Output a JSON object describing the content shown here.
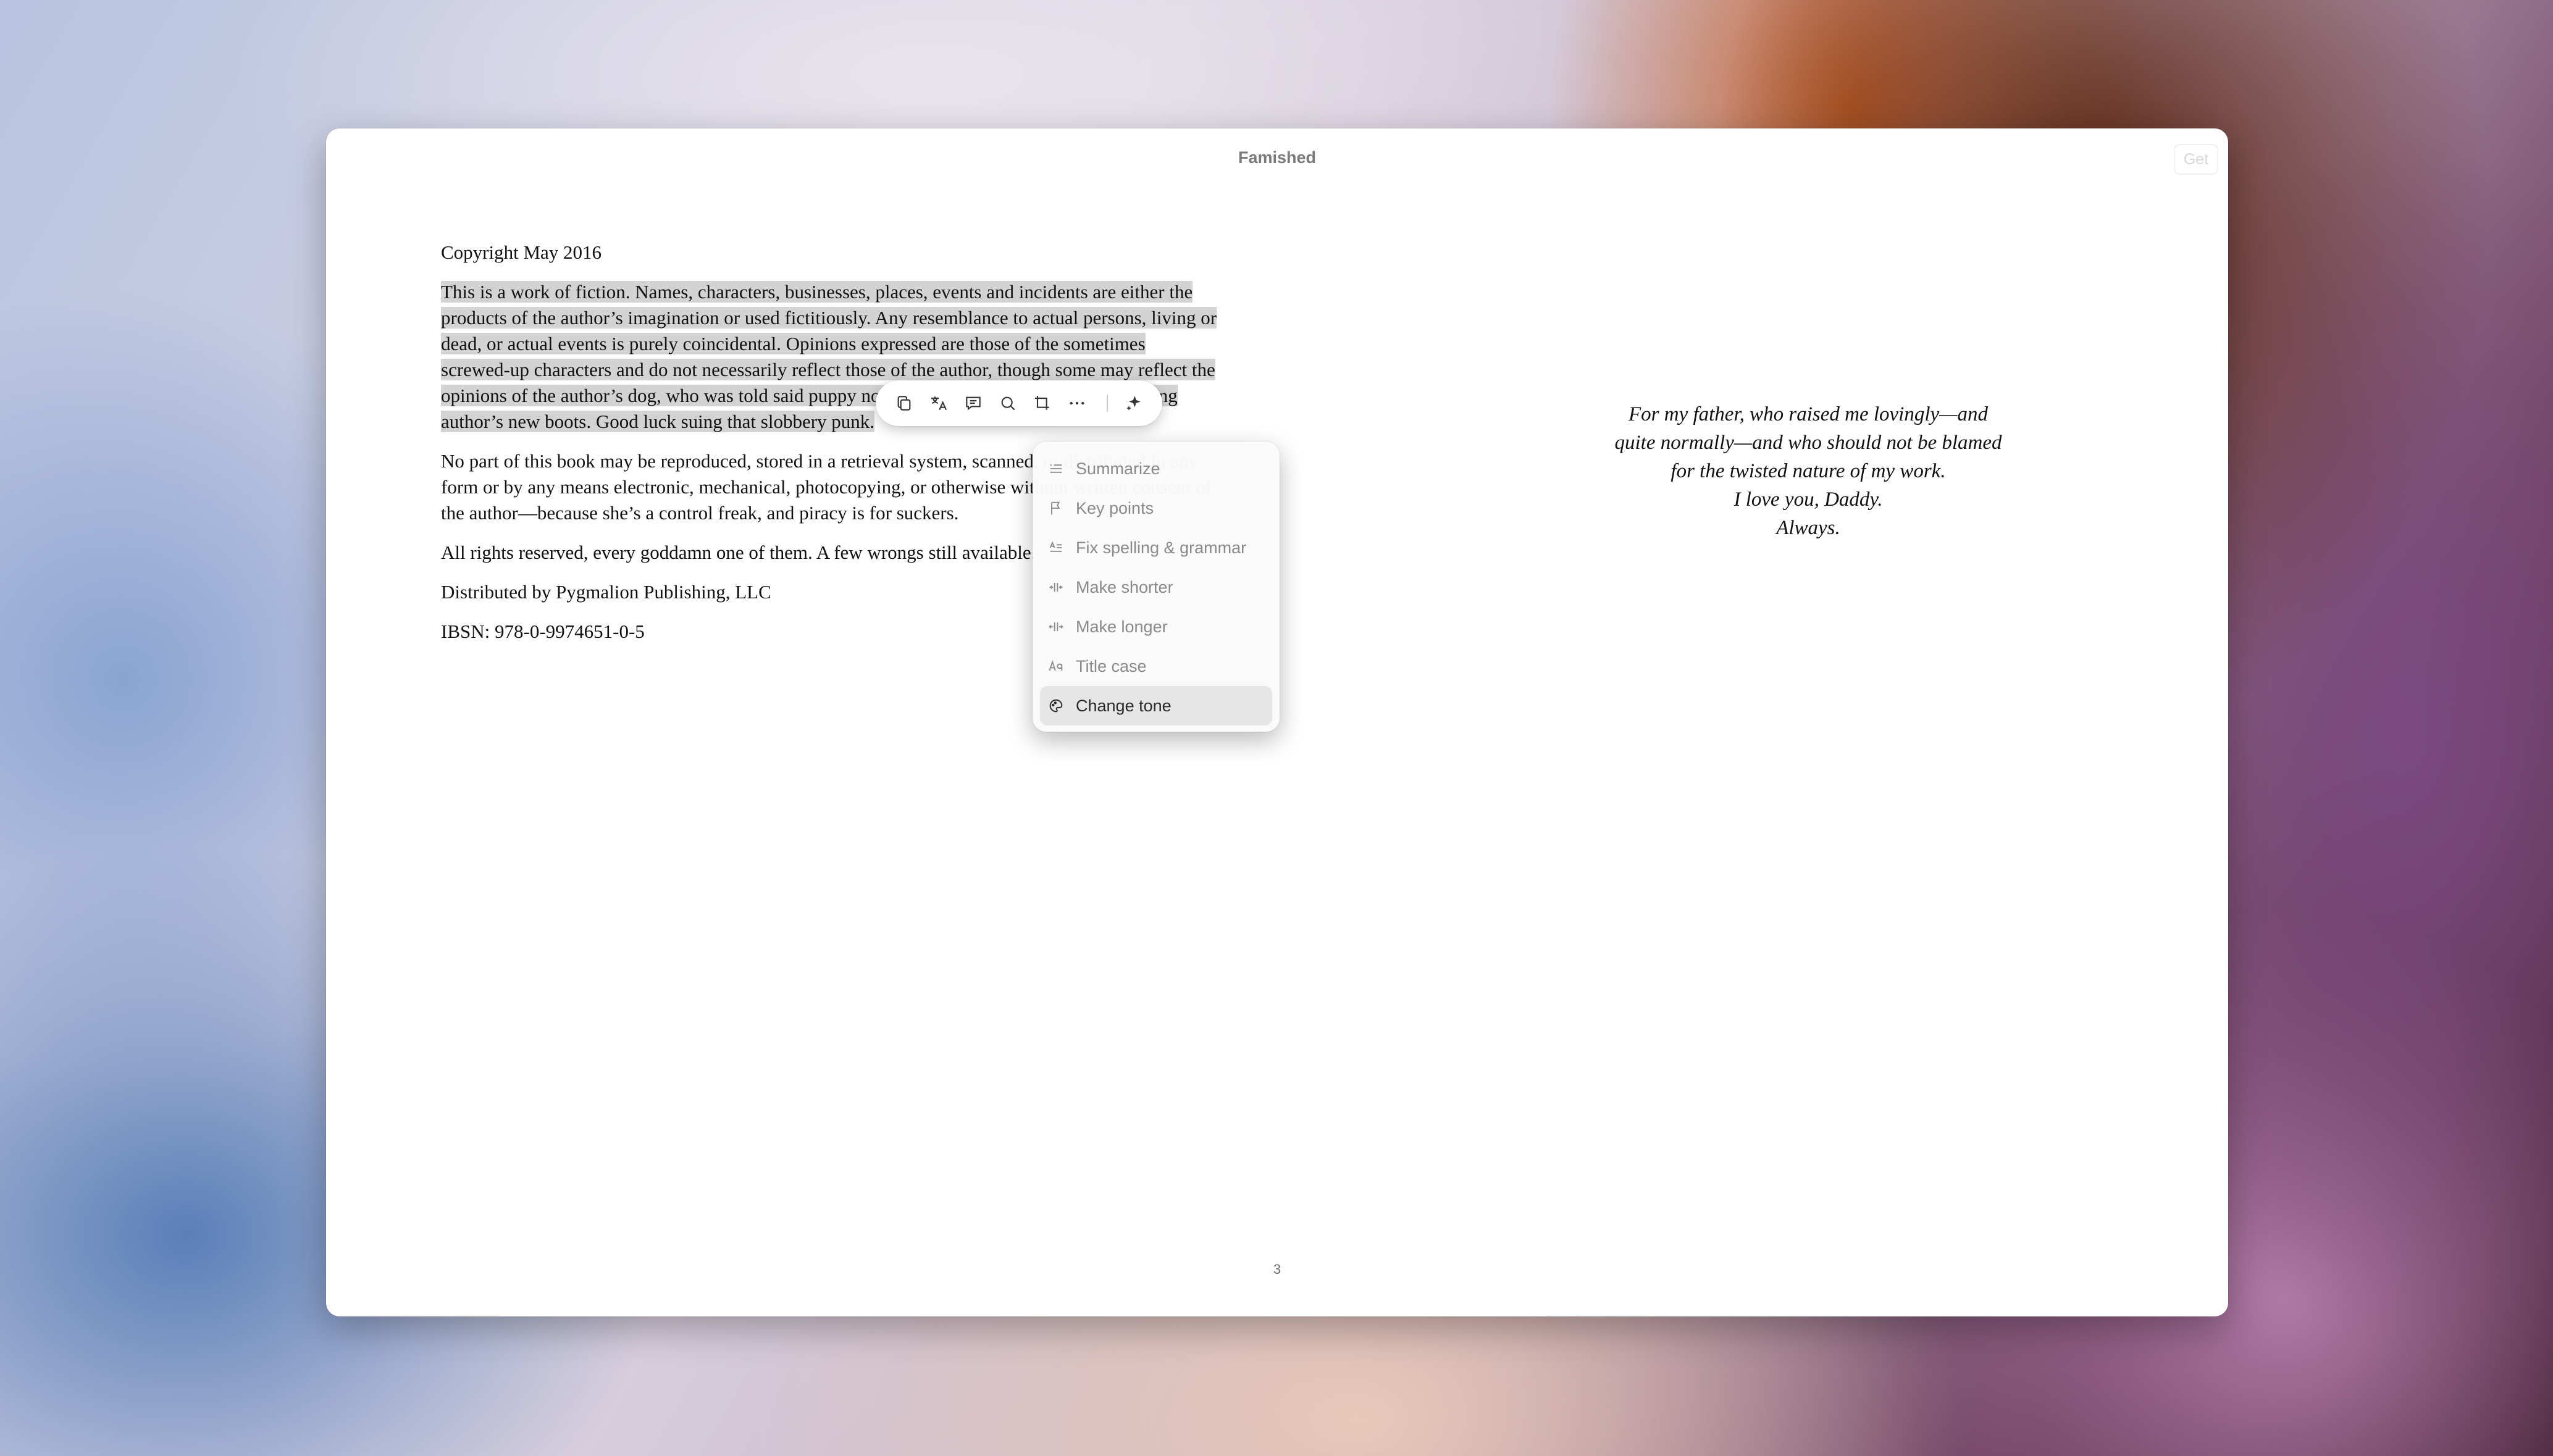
{
  "window": {
    "title": "Famished",
    "get_button_label": "Get"
  },
  "left_page": {
    "copyright_line": "Copyright May 2016",
    "selected_paragraph": "This is a work of fiction. Names, characters, businesses, places, events and incidents are either the products of the author’s imagination or used fictitiously. Any resemblance to actual persons, living or dead, or actual events is purely coincidental. Opinions expressed are those of the sometimes screwed-up characters and do not necessarily reflect those of the author, though some may reflect the opinions of the author’s dog, who was told said puppy not to be a jerk. Dog responded by eating author’s new boots. Good luck suing that slobbery punk.",
    "reproduction_paragraph": "No part of this book may be reproduced, stored in a retrieval system, scanned, or distributed in any form or by any means electronic, mechanical, photocopying, or otherwise without written consent of the author—because she’s a control freak, and piracy is for suckers.",
    "rights_line": "All rights reserved, every goddamn one of them. A few wrongs still available.",
    "distributor_line": "Distributed by Pygmalion Publishing, LLC",
    "ibsn_line": "IBSN: 978-0-9974651-0-5"
  },
  "right_page": {
    "dedication_lines": [
      "For my father, who raised me lovingly—and",
      "quite normally—and who should not be blamed",
      "for the twisted nature of my work.",
      "I love you, Daddy.",
      "Always."
    ]
  },
  "page_number": "3",
  "selection_toolbar": {
    "buttons": [
      {
        "name": "copy-icon"
      },
      {
        "name": "translate-icon"
      },
      {
        "name": "comment-icon"
      },
      {
        "name": "look-up-icon"
      },
      {
        "name": "crop-icon"
      },
      {
        "name": "more-icon"
      },
      {
        "name": "sparkle-icon"
      }
    ]
  },
  "writing_tools_menu": {
    "items": [
      {
        "label": "Summarize",
        "icon": "summarize-icon",
        "active": false
      },
      {
        "label": "Key points",
        "icon": "flag-icon",
        "active": false
      },
      {
        "label": "Fix spelling & grammar",
        "icon": "spelling-icon",
        "active": false
      },
      {
        "label": "Make shorter",
        "icon": "shorter-icon",
        "active": false
      },
      {
        "label": "Make longer",
        "icon": "longer-icon",
        "active": false
      },
      {
        "label": "Title case",
        "icon": "title-case-icon",
        "active": false
      },
      {
        "label": "Change tone",
        "icon": "tone-icon",
        "active": true
      }
    ]
  }
}
